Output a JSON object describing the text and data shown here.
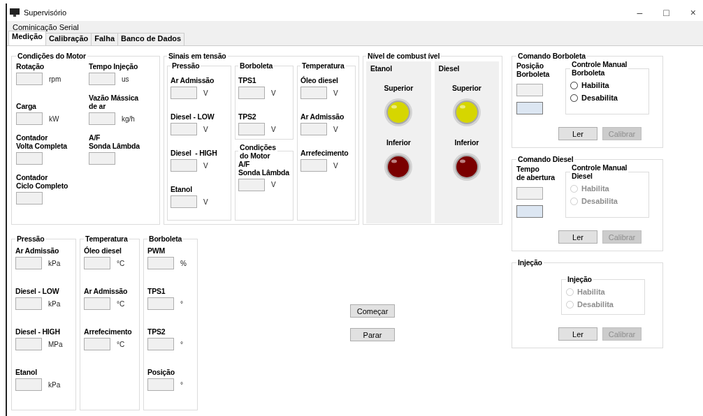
{
  "window": {
    "title": "Supervisório",
    "controls": [
      "–",
      "□",
      "×"
    ]
  },
  "menu": [
    "Cominicação Serial"
  ],
  "tabs": [
    {
      "label": "Medição",
      "selected": true
    },
    {
      "label": "Calibração",
      "selected": false
    },
    {
      "label": "Falha",
      "selected": false
    },
    {
      "label": "Banco de Dados",
      "selected": false
    }
  ],
  "engine_conditions": {
    "title": "Condições do Motor",
    "columns": [
      [
        {
          "label": "Rotação",
          "unit": "rpm"
        },
        {
          "label": "Carga",
          "unit": "kW"
        },
        {
          "label": "Contador\nVolta Completa"
        },
        {
          "label": "Contador\nCiclo Completo"
        }
      ],
      [
        {
          "label": "Tempo Injeção",
          "unit": "us"
        },
        {
          "label": "Vazão Mássica\nde ar",
          "unit": "kg/h"
        },
        {
          "label": "A/F\nSonda Lâmbda"
        }
      ]
    ]
  },
  "voltage_signals": {
    "title": "Sinais em tensão",
    "columns": [
      [
        {
          "title": "Pressão",
          "items": [
            {
              "label": "Ar Admissão",
              "unit": "V"
            },
            {
              "label": "Diesel - LOW",
              "unit": "V"
            },
            {
              "label": "Diesel  - HIGH",
              "unit": "V"
            },
            {
              "label": "Etanol",
              "unit": "V"
            }
          ]
        }
      ],
      [
        {
          "title": "Borboleta",
          "items": [
            {
              "label": "TPS1",
              "unit": "V"
            },
            {
              "label": "TPS2",
              "unit": "V"
            }
          ]
        },
        {
          "title": "Condições\ndo Motor",
          "items": [
            {
              "label": "A/F\nSonda Lâmbda",
              "unit": "V"
            }
          ]
        }
      ],
      [
        {
          "title": "Temperatura",
          "items": [
            {
              "label": "Óleo diesel",
              "unit": "V"
            },
            {
              "label": "Ar Admissão",
              "unit": "V"
            },
            {
              "label": "Arrefecimento",
              "unit": "V"
            }
          ]
        }
      ]
    ]
  },
  "fuel_level": {
    "title": "Nível de combust ível",
    "tanks": [
      {
        "name": "Etanol",
        "lamps": [
          {
            "label": "Superior",
            "color": "#d6d600"
          },
          {
            "label": "Inferior",
            "color": "#7a0000"
          }
        ]
      },
      {
        "name": "Diesel",
        "lamps": [
          {
            "label": "Superior",
            "color": "#d6d600"
          },
          {
            "label": "Inferior",
            "color": "#7a0000"
          }
        ]
      }
    ]
  },
  "readings": [
    {
      "title": "Pressão",
      "items": [
        {
          "label": "Ar Admissão",
          "unit": "kPa"
        },
        {
          "label": "Diesel - LOW",
          "unit": "kPa"
        },
        {
          "label": "Diesel - HIGH",
          "unit": "MPa"
        },
        {
          "label": "Etanol",
          "unit": "kPa"
        }
      ]
    },
    {
      "title": "Temperatura",
      "items": [
        {
          "label": "Óleo diesel",
          "unit": "°C"
        },
        {
          "label": "Ar Admissão",
          "unit": "°C"
        },
        {
          "label": "Arrefecimento",
          "unit": "°C"
        }
      ]
    },
    {
      "title": "Borboleta",
      "items": [
        {
          "label": "PWM",
          "unit": "%"
        },
        {
          "label": "TPS1",
          "unit": "°"
        },
        {
          "label": "TPS2",
          "unit": "°"
        },
        {
          "label": "Posição",
          "unit": "°"
        }
      ]
    }
  ],
  "actions": [
    "Começar",
    "Parar"
  ],
  "commands": [
    {
      "title": "Comando Borboleta",
      "field_label": "Posição\nBorboleta",
      "fields": [
        {
          "kind": "readonly"
        },
        {
          "kind": "input"
        }
      ],
      "manual": {
        "title": "Controle Manual\nBorboleta",
        "options": [
          {
            "label": "Habilita",
            "selected": false,
            "disabled": false
          },
          {
            "label": "Desabilita",
            "selected": false,
            "disabled": false
          }
        ]
      },
      "buttons": [
        {
          "label": "Ler",
          "disabled": false
        },
        {
          "label": "Calibrar",
          "disabled": true
        }
      ]
    },
    {
      "title": "Comando Diesel",
      "field_label": "Tempo\nde abertura",
      "fields": [
        {
          "kind": "readonly"
        },
        {
          "kind": "input"
        }
      ],
      "manual": {
        "title": "Controle Manual\nDiesel",
        "options": [
          {
            "label": "Habilita",
            "selected": false,
            "disabled": true
          },
          {
            "label": "Desabilita",
            "selected": false,
            "disabled": true
          }
        ]
      },
      "buttons": [
        {
          "label": "Ler",
          "disabled": false
        },
        {
          "label": "Calibrar",
          "disabled": true
        }
      ]
    },
    {
      "title": "Injeção",
      "manual": {
        "title": "Injeção",
        "options": [
          {
            "label": "Habilita",
            "selected": false,
            "disabled": true
          },
          {
            "label": "Desabilita",
            "selected": false,
            "disabled": true
          }
        ]
      },
      "buttons": [
        {
          "label": "Ler",
          "disabled": false
        },
        {
          "label": "Calibrar",
          "disabled": true
        }
      ]
    }
  ]
}
